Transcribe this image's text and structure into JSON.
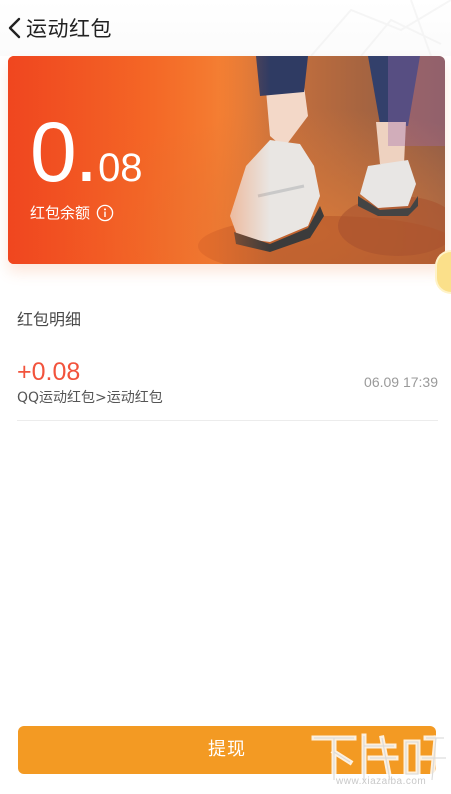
{
  "header": {
    "title": "运动红包"
  },
  "balance": {
    "integer": "0.",
    "decimal": "08",
    "label": "红包余额"
  },
  "details": {
    "section_title": "红包明细",
    "records": [
      {
        "amount": "+0.08",
        "description": "QQ运动红包>运动红包",
        "time": "06.09 17:39"
      }
    ]
  },
  "actions": {
    "withdraw_label": "提现"
  },
  "watermark": {
    "logo_text": "下载吧",
    "url": "www.xiazaiba.com"
  },
  "colors": {
    "accent": "#f39a23",
    "amount": "#f2533c",
    "card_start": "#f0461f"
  }
}
